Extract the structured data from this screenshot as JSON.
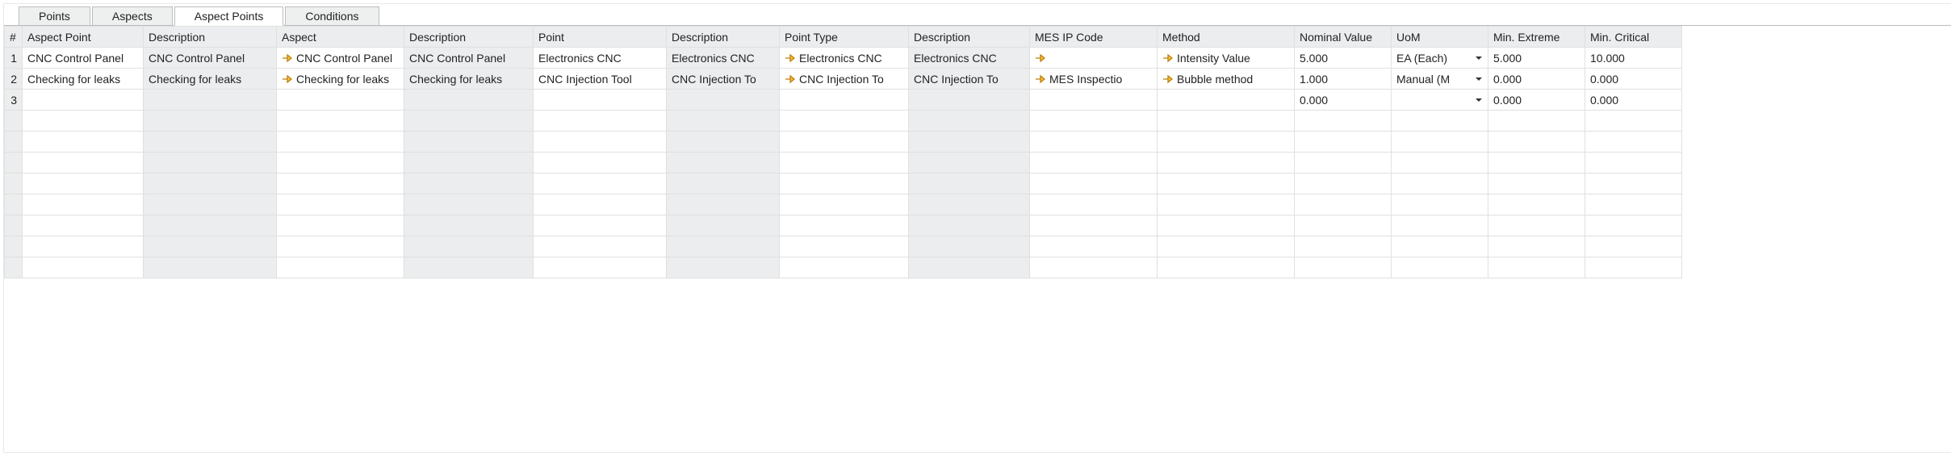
{
  "tabs": [
    "Points",
    "Aspects",
    "Aspect Points",
    "Conditions"
  ],
  "active_tab_index": 2,
  "columns": [
    {
      "key": "rownum",
      "label": "#",
      "cls": "c-num",
      "readonly": true,
      "align": "num"
    },
    {
      "key": "aspect_point",
      "label": "Aspect Point",
      "cls": "c-ap"
    },
    {
      "key": "aspect_point_desc",
      "label": "Description",
      "cls": "c-apd",
      "readonly": true
    },
    {
      "key": "aspect",
      "label": "Aspect",
      "cls": "c-asp",
      "arrow": true
    },
    {
      "key": "aspect_desc",
      "label": "Description",
      "cls": "c-aspd",
      "readonly": true
    },
    {
      "key": "point",
      "label": "Point",
      "cls": "c-pt"
    },
    {
      "key": "point_desc",
      "label": "Description",
      "cls": "c-ptd",
      "readonly": true
    },
    {
      "key": "point_type",
      "label": "Point Type",
      "cls": "c-pty",
      "arrow": true
    },
    {
      "key": "point_type_desc",
      "label": "Description",
      "cls": "c-ptyd",
      "readonly": true
    },
    {
      "key": "mes_ip",
      "label": "MES IP Code",
      "cls": "c-mes",
      "arrow": true
    },
    {
      "key": "method",
      "label": "Method",
      "cls": "c-meth",
      "arrow": true
    },
    {
      "key": "nominal",
      "label": "Nominal Value",
      "cls": "c-nom",
      "align": "num"
    },
    {
      "key": "uom",
      "label": "UoM",
      "cls": "c-uom",
      "dropdown": true
    },
    {
      "key": "min_ext",
      "label": "Min. Extreme",
      "cls": "c-minx",
      "align": "num"
    },
    {
      "key": "min_crit",
      "label": "Min. Critical",
      "cls": "c-minc",
      "align": "num"
    }
  ],
  "rows": [
    {
      "rownum": "1",
      "aspect_point": "CNC Control Panel",
      "aspect_point_desc": "CNC Control Panel",
      "aspect": "CNC Control Panel",
      "aspect_desc": "CNC Control Panel",
      "point": "Electronics CNC",
      "point_desc": "Electronics CNC",
      "point_type": "Electronics CNC",
      "point_type_desc": "Electronics CNC",
      "mes_ip": "",
      "method": "Intensity Value",
      "nominal": "5.000",
      "uom": "EA (Each)",
      "min_ext": "5.000",
      "min_crit": "10.000"
    },
    {
      "rownum": "2",
      "aspect_point": "Checking for leaks",
      "aspect_point_desc": "Checking for leaks",
      "aspect": "Checking for leaks",
      "aspect_desc": "Checking for leaks",
      "point": "CNC Injection Tool",
      "point_desc": "CNC Injection To",
      "point_type": "CNC Injection To",
      "point_type_desc": "CNC Injection To",
      "mes_ip": "MES Inspectio",
      "method": "Bubble method",
      "nominal": "1.000",
      "uom": "Manual (M",
      "min_ext": "0.000",
      "min_crit": "0.000"
    },
    {
      "rownum": "3",
      "aspect_point": "",
      "aspect_point_desc": "",
      "aspect": "",
      "aspect_desc": "",
      "point": "",
      "point_desc": "",
      "point_type": "",
      "point_type_desc": "",
      "mes_ip": "",
      "method": "",
      "nominal": "0.000",
      "uom": "",
      "min_ext": "0.000",
      "min_crit": "0.000"
    }
  ],
  "empty_row_count": 8,
  "icons": {
    "arrow_color_stroke": "#b97a00",
    "arrow_color_fill": "#ffbf3f"
  }
}
